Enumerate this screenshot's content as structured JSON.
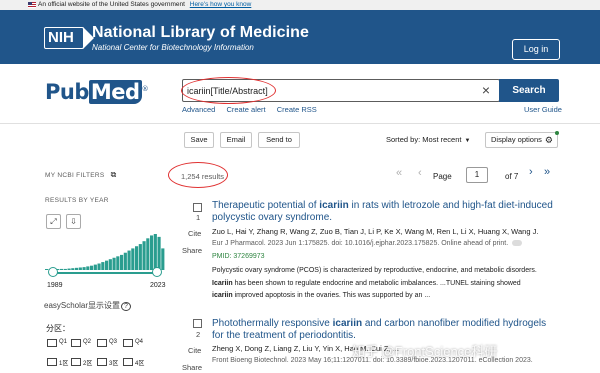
{
  "gov_banner": {
    "text": "An official website of the United States government",
    "link": "Here's how you know"
  },
  "header": {
    "logo": "NIH",
    "title": "National Library of Medicine",
    "subtitle": "National Center for Biotechnology Information",
    "login_label": "Log in"
  },
  "search": {
    "logo_pub": "Pub",
    "logo_med": "Med",
    "logo_reg": "®",
    "query": "icariin[Title/Abstract]",
    "clear_symbol": "×",
    "button_label": "Search",
    "links": [
      "Advanced",
      "Create alert",
      "Create RSS"
    ],
    "user_guide": "User Guide"
  },
  "toolbar": {
    "save": "Save",
    "email": "Email",
    "send_to": "Send to",
    "sorted_by": "Sorted by: Most recent",
    "display_options": "Display options"
  },
  "sidebar": {
    "filters_label": "MY NCBI FILTERS",
    "results_by_year_label": "RESULTS BY YEAR",
    "year_start": "1989",
    "year_end": "2023",
    "histogram_relative": [
      0.02,
      0.02,
      0.03,
      0.02,
      0.03,
      0.03,
      0.04,
      0.05,
      0.06,
      0.07,
      0.08,
      0.1,
      0.12,
      0.15,
      0.18,
      0.22,
      0.26,
      0.3,
      0.34,
      0.38,
      0.42,
      0.48,
      0.54,
      0.6,
      0.66,
      0.72,
      0.8,
      0.88,
      0.96,
      1.0,
      0.92,
      0.6
    ],
    "easyscholar_label": "easyScholar显示设置",
    "partition_label": "分区：",
    "quartiles": [
      "Q1",
      "Q2",
      "Q3",
      "Q4"
    ],
    "zones": [
      "1区",
      "2区",
      "3区",
      "4区"
    ]
  },
  "results": {
    "count": "1,254 results",
    "page_label": "Page",
    "page_value": "1",
    "of_label": "of 7",
    "cite_label": "Cite",
    "share_label": "Share",
    "items": [
      {
        "number": "1",
        "title_pre": "Therapeutic potential of ",
        "title_bold": "icariin",
        "title_post": " in rats with letrozole and high-fat diet-induced polycystic ovary syndrome.",
        "authors": "Zuo L, Hai Y, Zhang R, Wang Z, Zuo B, Tian J, Li P, Ke X, Wang M, Ren L, Li X, Huang X, Wang J.",
        "citation": "Eur J Pharmacol. 2023 Jun 1:175825. doi: 10.1016/j.ejphar.2023.175825. Online ahead of print.",
        "pmid": "PMID: 37269973",
        "snippet_1": "Polycystic ovary syndrome (PCOS) is characterized by reproductive, endocrine, and metabolic disorders.",
        "snippet_2_bold": "Icariin",
        "snippet_2": " has been shown to regulate endocrine and metabolic imbalances. ...TUNEL staining showed",
        "snippet_3_bold": "icariin",
        "snippet_3": " improved apoptosis in the ovaries. This was supported by an ..."
      },
      {
        "number": "2",
        "title_pre": "Photothermally responsive ",
        "title_bold": "icariin",
        "title_post": " and carbon nanofiber modified hydrogels for the treatment of periodontitis.",
        "authors": "Zheng X, Dong Z, Liang Z, Liu Y, Yin X, Han M, Cui Z, ...",
        "citation": "Front Bioeng Biotechnol. 2023 May 16;11:1207011. doi: 10.3389/fbioe.2023.1207011. eCollection 2023."
      }
    ]
  },
  "watermark": "知乎 @FrontScience科研"
}
